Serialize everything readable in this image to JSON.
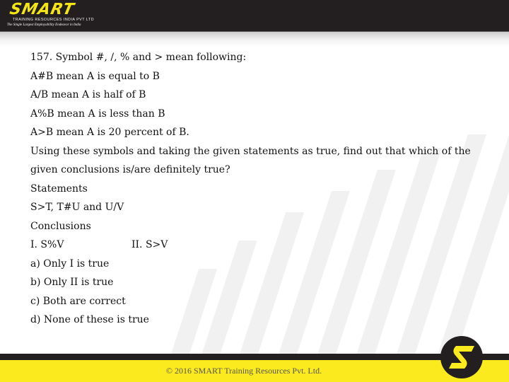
{
  "header": {
    "brand": "SMART",
    "company": "TRAINING RESOURCES INDIA PVT LTD",
    "tagline": "The Single Largest Employability Endeavor in India"
  },
  "question": {
    "title": "157.  Symbol #, /, % and > mean following:",
    "definitions": [
      "A#B  mean A is equal to B",
      "A/B mean A is half of B",
      "A%B mean A is less than B",
      "A>B mean A is 20 percent of B."
    ],
    "instruction": "Using these symbols  and taking the given statements as true, find out that which of the given conclusions is/are definitely true?",
    "statements_label": "Statements",
    "statements": "S>T, T#U and U/V",
    "conclusions_label": "Conclusions",
    "conclusions": [
      "I. S%V",
      "II. S>V"
    ],
    "options": [
      "a) Only I is true",
      "b) Only II is true",
      "c) Both are correct",
      "d) None of these is true"
    ]
  },
  "footer": {
    "copyright": "© 2016 SMART Training Resources Pvt. Ltd.",
    "badge_icon": "smart-s-logo-icon"
  },
  "colors": {
    "brand_yellow": "#fbeb1e",
    "brand_dark": "#231f20"
  }
}
